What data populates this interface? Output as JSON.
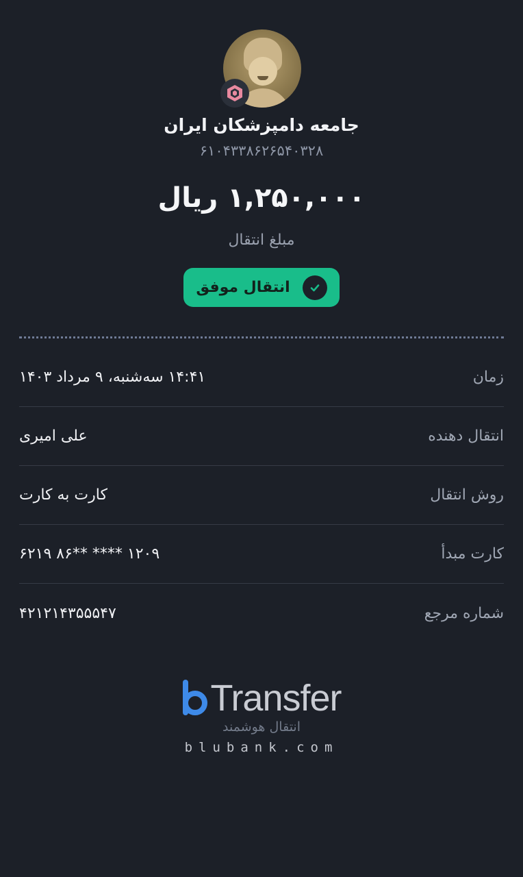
{
  "header": {
    "avatar_icon": "user-avatar",
    "bank_icon": "bank-logo-icon",
    "recipient_name": "جامعه دامپزشکان ایران",
    "account_number": "۶۱۰۴۳۳۸۶۲۶۵۴۰۳۲۸"
  },
  "amount": {
    "value": "۱,۲۵۰,۰۰۰ ریال",
    "label": "مبلغ انتقال"
  },
  "status": {
    "text": "انتقال موفق",
    "icon": "check-icon",
    "color": "#19bd8a"
  },
  "details": [
    {
      "label": "زمان",
      "value": "۱۴:۴۱ سه‌شنبه، ۹ مرداد ۱۴۰۳"
    },
    {
      "label": "انتقال دهنده",
      "value": "علی امیری"
    },
    {
      "label": "روش انتقال",
      "value": "کارت به کارت"
    },
    {
      "label": "کارت مبدأ",
      "value": "۶۲۱۹ ۸۶** **** ۱۲۰۹"
    },
    {
      "label": "شماره مرجع",
      "value": "۴۲۱۲۱۴۳۵۵۵۴۷"
    }
  ],
  "footer": {
    "brand_word": "Transfer",
    "tagline": "انتقال هوشمند",
    "url": "blubank.com",
    "brand_color": "#3e8ae8"
  }
}
